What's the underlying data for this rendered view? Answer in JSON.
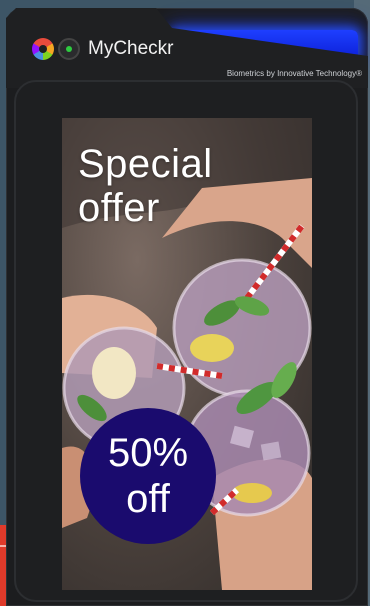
{
  "header": {
    "brand": "MyCheckr",
    "tagline": "Biometrics by Innovative Technology®",
    "logo_icon": "aperture-logo-icon",
    "status_icon": "green-dot-icon"
  },
  "ad": {
    "title": "Special\noffer",
    "badge_line1": "50%",
    "badge_line2": "off",
    "badge_color": "#1a0b6e"
  },
  "colors": {
    "accent_glow": "#1e3fff",
    "device": "#1c1d1f"
  }
}
